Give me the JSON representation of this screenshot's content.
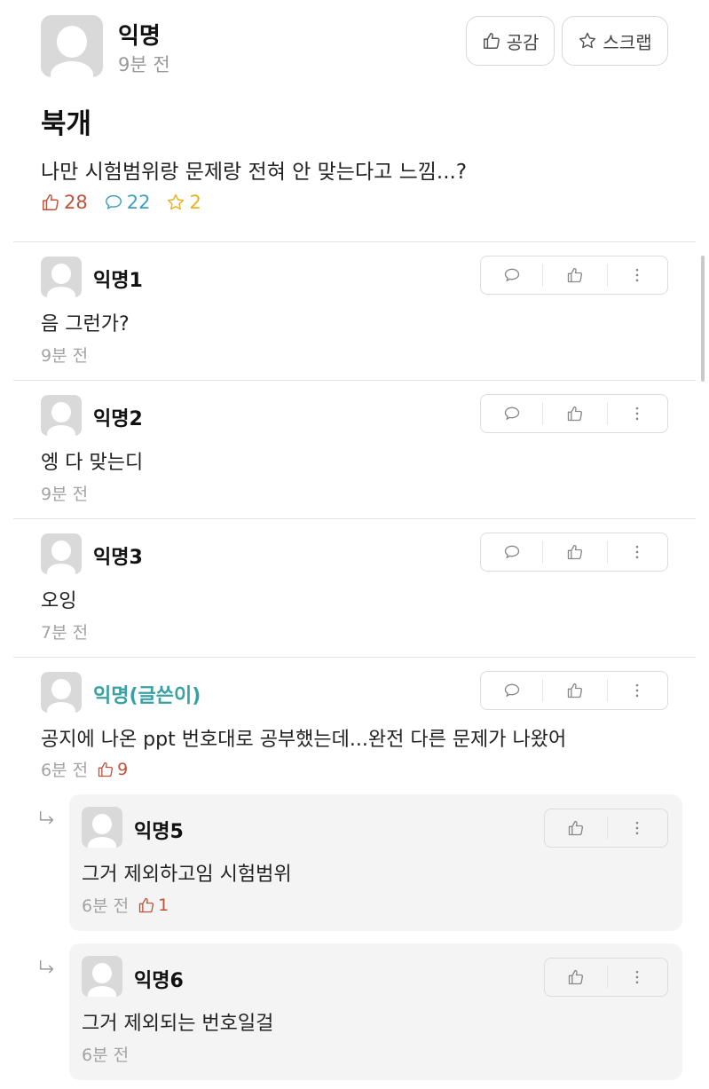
{
  "post": {
    "author": "익명",
    "time": "9분 전",
    "like_button": "공감",
    "scrap_button": "스크랩",
    "title": "북개",
    "body": "나만 시험범위랑 문제랑 전혀 안 맞는다고 느낌...?",
    "stats": {
      "likes": "28",
      "comments": "22",
      "scraps": "2"
    }
  },
  "comments": [
    {
      "author": "익명1",
      "text": "음 그런가?",
      "time": "9분 전"
    },
    {
      "author": "익명2",
      "text": "엥 다 맞는디",
      "time": "9분 전"
    },
    {
      "author": "익명3",
      "text": "오잉",
      "time": "7분 전"
    },
    {
      "author": "익명(글쓴이)",
      "text": "공지에 나온 ppt 번호대로 공부했는데...완전 다른 문제가 나왔어",
      "time": "6분 전",
      "likes": "9"
    }
  ],
  "replies": [
    {
      "author": "익명5",
      "text": "그거 제외하고임 시험범위",
      "time": "6분 전",
      "likes": "1"
    },
    {
      "author": "익명6",
      "text": "그거 제외되는 번호일걸",
      "time": "6분 전"
    }
  ],
  "colors": {
    "like": "#c0523a",
    "comment": "#3f9fbd",
    "scrap": "#e5b320",
    "op_name": "#3aa1a3",
    "muted": "#a3a3a3"
  },
  "icons": [
    "thumbs-up-icon",
    "star-icon",
    "speech-bubble-icon",
    "more-vertical-icon",
    "reply-arrow-icon",
    "avatar-icon"
  ]
}
